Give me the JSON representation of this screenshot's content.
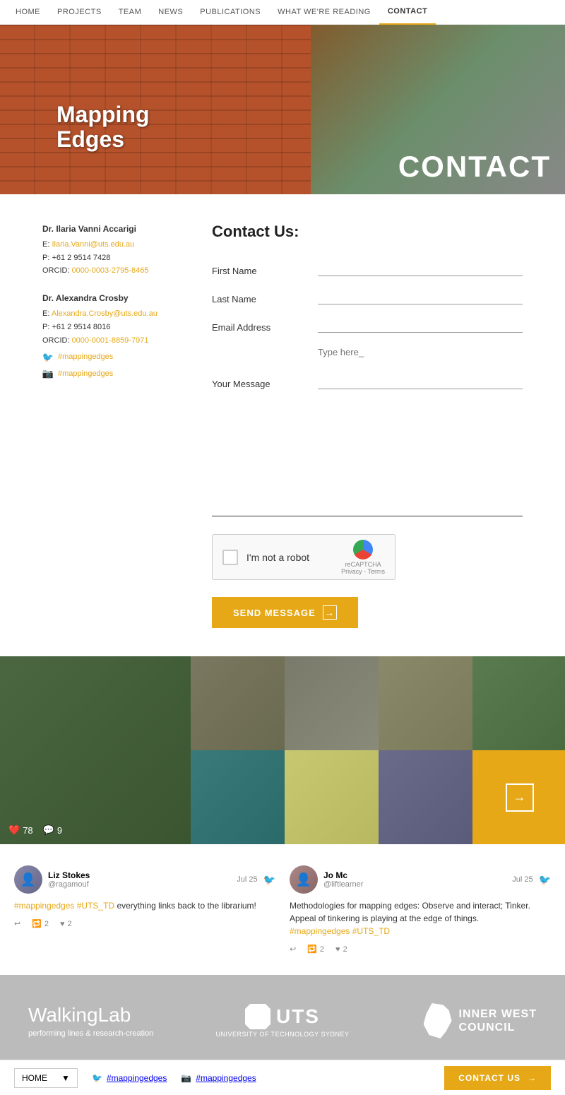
{
  "nav": {
    "items": [
      {
        "label": "HOME",
        "href": "#",
        "active": false
      },
      {
        "label": "PROJECTS",
        "href": "#",
        "active": false
      },
      {
        "label": "TEAM",
        "href": "#",
        "active": false
      },
      {
        "label": "NEWS",
        "href": "#",
        "active": false
      },
      {
        "label": "PUBLICATIONS",
        "href": "#",
        "active": false
      },
      {
        "label": "WHAT WE'RE READING",
        "href": "#",
        "active": false
      },
      {
        "label": "CONTACT",
        "href": "#",
        "active": true
      }
    ]
  },
  "hero": {
    "title_line1": "Mapping",
    "title_line2": "Edges",
    "contact_label": "CONTACT"
  },
  "contact_left": {
    "person1_name": "Dr. Ilaria Vanni Accarigi",
    "person1_email": "Ilaria.Vanni@uts.edu.au",
    "person1_email_label": "E:",
    "person1_phone": "P: +61 2 9514 7428",
    "person1_orcid_label": "ORCID:",
    "person1_orcid": "0000-0003-2795-8465",
    "person2_name": "Dr. Alexandra Crosby",
    "person2_email": "Alexandra.Crosby@uts.edu.au",
    "person2_email_label": "E:",
    "person2_phone": "P: +61 2 9514 8016",
    "person2_orcid_label": "ORCID:",
    "person2_orcid": "0000-0001-8859-7971",
    "twitter_handle": "#mappingedges",
    "instagram_handle": "#mappingedges"
  },
  "contact_form": {
    "heading": "Contact Us:",
    "first_name_label": "First Name",
    "last_name_label": "Last Name",
    "email_label": "Email Address",
    "message_label": "Your Message",
    "message_placeholder": "Type here_",
    "recaptcha_text": "I'm not a robot",
    "recaptcha_sub": "reCAPTCHA",
    "recaptcha_privacy": "Privacy - Terms",
    "send_button": "SEND MESSAGE"
  },
  "instagram": {
    "likes": "78",
    "comments": "9",
    "arrow_label": "→"
  },
  "tweets": [
    {
      "name": "Liz Stokes",
      "handle": "@ragamouf",
      "date": "Jul 25",
      "text": "#mappingedges #UTS_TD everything links back to the librarium!",
      "hashtag1": "#mappingedges",
      "hashtag2": "#UTS_TD",
      "retweets": "2",
      "likes": "2"
    },
    {
      "name": "Jo Mc",
      "handle": "@liftlearner",
      "date": "Jul 25",
      "text": "Methodologies for mapping edges: Observe and interact; Tinker. Appeal of tinkering is playing at the edge of things.",
      "hashtag1": "#mappingedges",
      "hashtag2": "#UTS_TD",
      "retweets": "2",
      "likes": "2"
    }
  ],
  "footer": {
    "walking_lab": "WalkingLab",
    "walking_sub": "performing lines & research-creation",
    "uts_label": "UTS",
    "uts_full": "UNIVERSITY OF TECHNOLOGY SYDNEY",
    "inner_west": "INNER WEST",
    "council": "COUNCIL"
  },
  "bottom_bar": {
    "home_label": "HOME",
    "twitter": "#mappingedges",
    "instagram": "#mappingedges",
    "contact_us": "CONTACT US"
  }
}
